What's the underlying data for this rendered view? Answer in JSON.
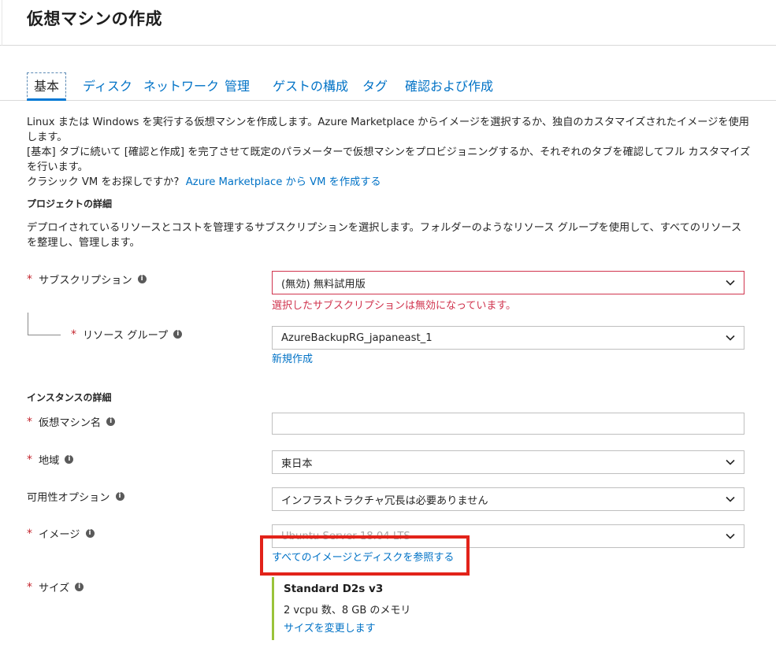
{
  "page": {
    "title": "仮想マシンの作成"
  },
  "tabs": [
    {
      "label": "基本"
    },
    {
      "label": "ディスク"
    },
    {
      "label": "ネットワーク"
    },
    {
      "label": "管理"
    },
    {
      "label": "ゲストの構成"
    },
    {
      "label": "タグ"
    },
    {
      "label": "確認および作成"
    }
  ],
  "intro": {
    "line1": "Linux または Windows を実行する仮想マシンを作成します。Azure Marketplace からイメージを選択するか、独自のカスタマイズされたイメージを使用します。",
    "line2": "[基本] タブに続いて [確認と作成] を完了させて既定のパラメーターで仮想マシンをプロビジョニングするか、それぞれのタブを確認してフル カスタマイズを行います。",
    "classic_prefix": "クラシック VM をお探しですか?",
    "classic_link": "Azure Marketplace から VM を作成する"
  },
  "project": {
    "title": "プロジェクトの詳細",
    "description": "デプロイされているリソースとコストを管理するサブスクリプションを選択します。フォルダーのようなリソース グループを使用して、すべてのリソースを整理し、管理します。",
    "subscription": {
      "label": "サブスクリプション",
      "value": "(無効) 無料試用版",
      "error": "選択したサブスクリプションは無効になっています。"
    },
    "resource_group": {
      "label": "リソース グループ",
      "value": "AzureBackupRG_japaneast_1",
      "create_new": "新規作成"
    }
  },
  "instance": {
    "title": "インスタンスの詳細",
    "vm_name": {
      "label": "仮想マシン名",
      "value": ""
    },
    "region": {
      "label": "地域",
      "value": "東日本"
    },
    "availability": {
      "label": "可用性オプション",
      "value": "インフラストラクチャ冗長は必要ありません"
    },
    "image": {
      "label": "イメージ",
      "value": "Ubuntu Server 18.04 LTS",
      "browse_link": "すべてのイメージとディスクを参照する"
    },
    "size": {
      "label": "サイズ",
      "name": "Standard D2s v3",
      "spec": "2 vcpu 数、8 GB のメモリ",
      "change_link": "サイズを変更します"
    }
  },
  "symbols": {
    "required": "*",
    "info": "i"
  },
  "colors": {
    "link": "#0072c6",
    "error": "#d0344e",
    "required": "#c4262e",
    "tab_underline": "#0078d4",
    "highlight": "#e2231a",
    "size_accent": "#9ac33a"
  }
}
